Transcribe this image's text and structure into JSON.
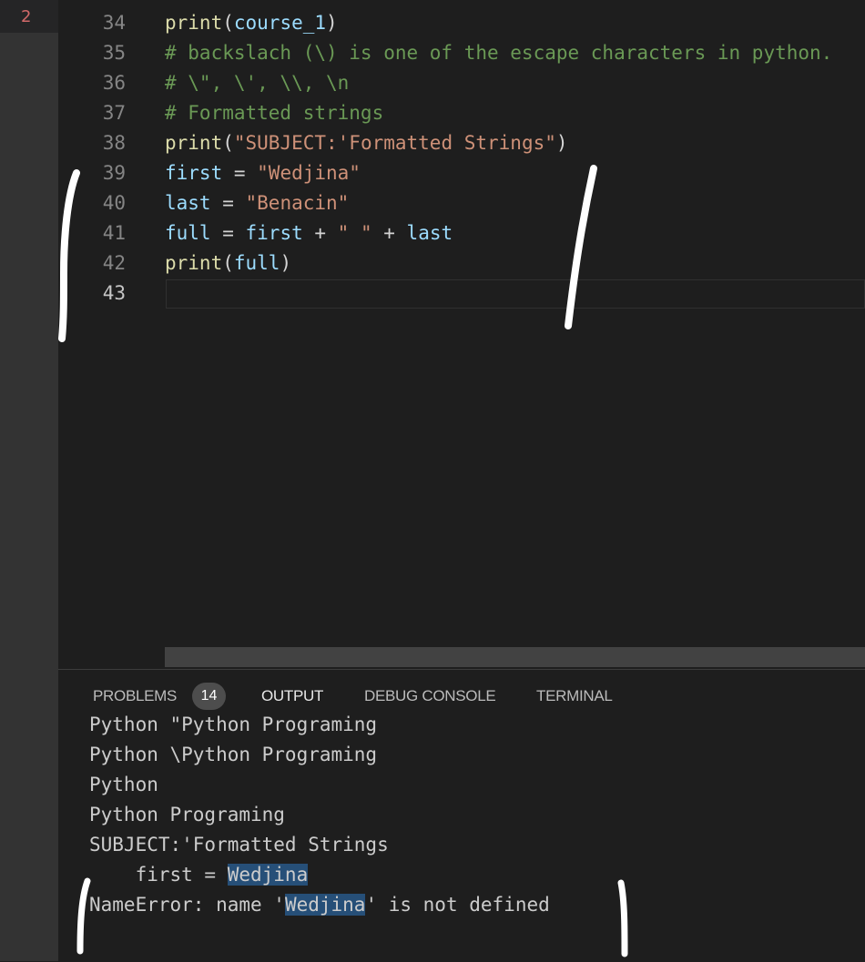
{
  "activity_badge": "2",
  "editor": {
    "lines": [
      {
        "num": "34",
        "tokens": [
          [
            "kw",
            "print"
          ],
          [
            "pun",
            "("
          ],
          [
            "var",
            "course_1"
          ],
          [
            "pun",
            ")"
          ]
        ]
      },
      {
        "num": "35",
        "tokens": [
          [
            "com",
            "# backslach (\\) is one of the escape characters in python."
          ]
        ]
      },
      {
        "num": "36",
        "tokens": [
          [
            "com",
            "# \\\", \\', \\\\, \\n"
          ]
        ]
      },
      {
        "num": "37",
        "tokens": [
          [
            "com",
            "# Formatted strings"
          ]
        ]
      },
      {
        "num": "38",
        "tokens": [
          [
            "kw",
            "print"
          ],
          [
            "pun",
            "("
          ],
          [
            "str",
            "\"SUBJECT:'Formatted Strings\""
          ],
          [
            "pun",
            ")"
          ]
        ]
      },
      {
        "num": "39",
        "tokens": [
          [
            "var",
            "first"
          ],
          [
            "pun",
            " = "
          ],
          [
            "str",
            "\"Wedjina\""
          ]
        ]
      },
      {
        "num": "40",
        "tokens": [
          [
            "var",
            "last"
          ],
          [
            "pun",
            " = "
          ],
          [
            "str",
            "\"Benacin\""
          ]
        ]
      },
      {
        "num": "41",
        "tokens": [
          [
            "var",
            "full"
          ],
          [
            "pun",
            " = "
          ],
          [
            "var",
            "first"
          ],
          [
            "pun",
            " + "
          ],
          [
            "str",
            "\" \""
          ],
          [
            "pun",
            " + "
          ],
          [
            "var",
            "last"
          ]
        ]
      },
      {
        "num": "42",
        "tokens": [
          [
            "kw",
            "print"
          ],
          [
            "pun",
            "("
          ],
          [
            "var",
            "full"
          ],
          [
            "pun",
            ")"
          ]
        ]
      },
      {
        "num": "43",
        "tokens": []
      }
    ]
  },
  "panel": {
    "tabs": {
      "problems": "PROBLEMS",
      "problems_count": "14",
      "output": "OUTPUT",
      "debug_console": "DEBUG CONSOLE",
      "terminal": "TERMINAL"
    },
    "output_lines": {
      "l1": "Python \"Python Programing",
      "l2": "Python \\Python Programing",
      "l3": "Python",
      "l4": "Python Programing",
      "l5": "SUBJECT:'Formatted Strings",
      "l6_prefix": "    first = ",
      "l6_value": "Wedjina",
      "l7_prefix": "NameError: name '",
      "l7_value": "Wedjina",
      "l7_suffix": "' is not defined"
    }
  },
  "colors": {
    "background": "#1e1e1e",
    "function": "#dcdcaa",
    "variable": "#9cdcfe",
    "string": "#ce9178",
    "comment": "#6a9955",
    "marker": "#ffffff"
  }
}
